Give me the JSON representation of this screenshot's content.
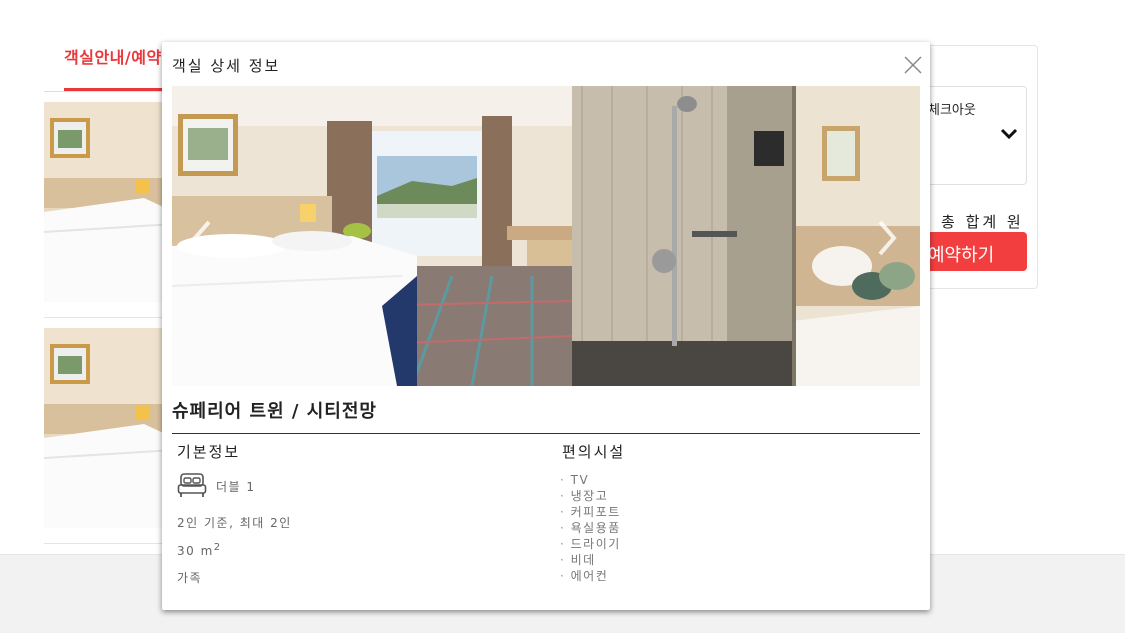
{
  "background": {
    "tab_active": "객실안내/예약",
    "checkout_label": "체크아웃",
    "total_text": "총 합계 원",
    "book_button": "예약하기"
  },
  "modal": {
    "title": "객실 상세 정보",
    "room_name": "슈페리어 트윈 / 시티전망",
    "basic_info": {
      "heading": "기본정보",
      "bed": "더블 1",
      "occupancy": "2인 기준, 최대 2인",
      "size_value": "30 m",
      "size_unit_sup": "2",
      "type": "가족"
    },
    "amenities": {
      "heading": "편의시설",
      "items": [
        "TV",
        "냉장고",
        "커피포트",
        "욕실용품",
        "드라이기",
        "비데",
        "에어컨"
      ]
    }
  },
  "colors": {
    "accent": "#e8383d",
    "book_button": "#f23e3e",
    "footer": "#f2f2f2"
  },
  "icons": [
    "close-icon",
    "chevron-left-icon",
    "chevron-right-icon",
    "chevron-down-icon",
    "bed-icon"
  ]
}
